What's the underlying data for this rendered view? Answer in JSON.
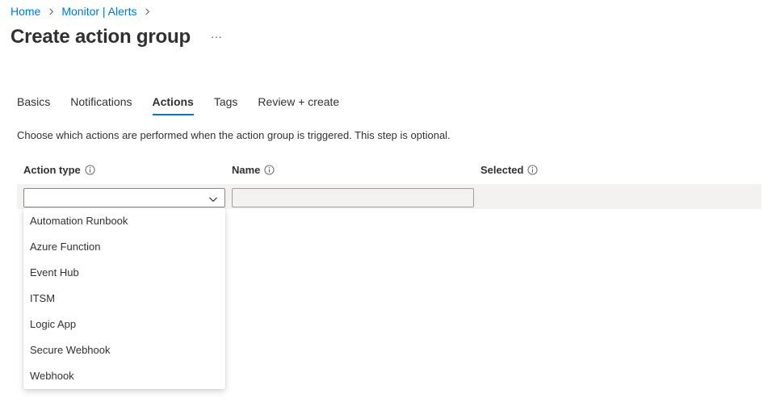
{
  "breadcrumb": {
    "items": [
      "Home",
      "Monitor | Alerts"
    ]
  },
  "page": {
    "title": "Create action group",
    "more_label": "···"
  },
  "tabs": [
    {
      "label": "Basics",
      "active": false
    },
    {
      "label": "Notifications",
      "active": false
    },
    {
      "label": "Actions",
      "active": true
    },
    {
      "label": "Tags",
      "active": false
    },
    {
      "label": "Review + create",
      "active": false
    }
  ],
  "description": "Choose which actions are performed when the action group is triggered. This step is optional.",
  "table": {
    "headers": [
      "Action type",
      "Name",
      "Selected"
    ],
    "row": {
      "action_type_value": "",
      "name_value": ""
    }
  },
  "dropdown": {
    "options": [
      "Automation Runbook",
      "Azure Function",
      "Event Hub",
      "ITSM",
      "Logic App",
      "Secure Webhook",
      "Webhook"
    ]
  },
  "colors": {
    "accent": "#0078d4",
    "text": "#323130",
    "band": "#f3f2f1"
  },
  "icons": {
    "breadcrumb_separator": "chevron-right-icon",
    "info": "info-icon",
    "dropdown": "chevron-down-icon",
    "more": "more-ellipsis-icon"
  }
}
